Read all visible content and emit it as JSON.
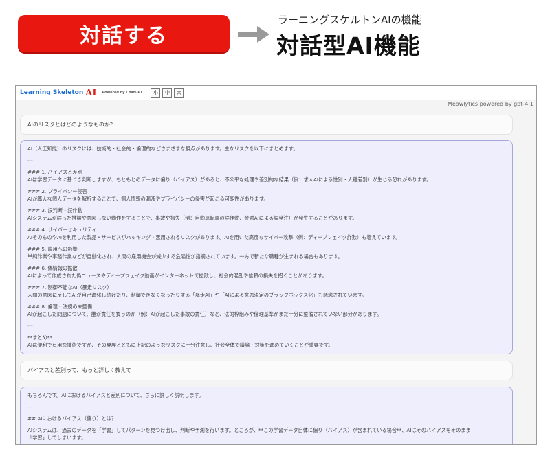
{
  "banner": {
    "button_label": "対話する",
    "subtitle": "ラーニングスケルトンAIの機能",
    "title": "対話型AI機能"
  },
  "app": {
    "logo_text": "Learning Skeleton",
    "logo_ai": "AI",
    "powered_by": "Powered by ChatGPT",
    "size_buttons": [
      "小",
      "中",
      "大"
    ],
    "credit": "Meowlytics powered by gpt-4.1"
  },
  "chat": {
    "user_message_1": "AIのリスクとはどのようなものか？",
    "ai_message_1": [
      {
        "type": "line",
        "text": "AI（人工知能）のリスクには、技術的・社会的・倫理的などさまざまな観点があります。主なリスクを以下にまとめます。"
      },
      {
        "type": "gap"
      },
      {
        "type": "sep",
        "text": "---"
      },
      {
        "type": "gap"
      },
      {
        "type": "line",
        "text": "### 1. バイアスと差別"
      },
      {
        "type": "line",
        "text": "AIは学習データに基づき判断しますが、もともとのデータに偏り（バイアス）があると、不公平な処理や差別的な結果（例：求人AIによる性別・人種差別）が生じる恐れがあります。"
      },
      {
        "type": "gap"
      },
      {
        "type": "line",
        "text": "### 2. プライバシー侵害"
      },
      {
        "type": "line",
        "text": "AIが膨大な個人データを解析することで、個人情報の漏洩やプライバシーの侵害が起こる可能性があります。"
      },
      {
        "type": "gap"
      },
      {
        "type": "line",
        "text": "### 3. 誤判断・誤作動"
      },
      {
        "type": "line",
        "text": "AIシステムが誤った推論や意図しない動作をすることで、事故や損失（例：自動運転車の誤作動、金融AIによる誤発注）が発生することがあります。"
      },
      {
        "type": "gap"
      },
      {
        "type": "line",
        "text": "### 4. サイバーセキュリティ"
      },
      {
        "type": "line",
        "text": "AIそのものやAIを利用した製品・サービスがハッキング・悪用されるリスクがあります。AIを用いた高度なサイバー攻撃（例：ディープフェイク詐欺）も増えています。"
      },
      {
        "type": "gap"
      },
      {
        "type": "line",
        "text": "### 5. 雇用への影響"
      },
      {
        "type": "line",
        "text": "単純作業や事務作業などが自動化され、人間の雇用機会が減少する危険性が指摘されています。一方で新たな職種が生まれる場合もあります。"
      },
      {
        "type": "gap"
      },
      {
        "type": "line",
        "text": "### 6. 偽情報の拡散"
      },
      {
        "type": "line",
        "text": "AIによって作成された偽ニュースやディープフェイク動画がインターネットで拡散し、社会的混乱や信頼の損失を招くことがあります。"
      },
      {
        "type": "gap"
      },
      {
        "type": "line",
        "text": "### 7. 制御不能なAI（暴走リスク）"
      },
      {
        "type": "line",
        "text": "人間の意図に反してAIが自己進化し続けたり、制御できなくなったりする「暴走AI」や「AIによる意思決定のブラックボックス化」も懸念されています。"
      },
      {
        "type": "gap"
      },
      {
        "type": "line",
        "text": "### 8. 倫理・法規の未整備"
      },
      {
        "type": "line",
        "text": "AIが起こした問題について、誰が責任を負うのか（例：AIが起こした事故の責任）など、法的枠組みや倫理基準がまだ十分に整備されていない部分があります。"
      },
      {
        "type": "gap"
      },
      {
        "type": "sep",
        "text": "---"
      },
      {
        "type": "gap"
      },
      {
        "type": "line",
        "text": "**まとめ**"
      },
      {
        "type": "line",
        "text": "AIは便利で有用な技術ですが、その発展とともに上記のようなリスクに十分注意し、社会全体で議論・対策を進めていくことが重要です。"
      }
    ],
    "user_message_2": "バイアスと差別って、もっと詳しく教えて",
    "ai_message_2": [
      {
        "type": "line",
        "text": "もちろんです。AIにおけるバイアスと差別について、さらに詳しく説明します。"
      },
      {
        "type": "gap"
      },
      {
        "type": "sep",
        "text": "---"
      },
      {
        "type": "gap"
      },
      {
        "type": "line",
        "text": "## AIにおけるバイアス（偏り）とは？"
      },
      {
        "type": "gap"
      },
      {
        "type": "line",
        "text": "AIシステムは、過去のデータを「学習」してパターンを見つけ出し、判断や予測を行います。ところが、**この学習データ自体に偏り（バイアス）が含まれている場合**、AIはそのバイアスをそのまま"
      },
      {
        "type": "line",
        "text": "「学習」してしまいます。"
      }
    ]
  }
}
